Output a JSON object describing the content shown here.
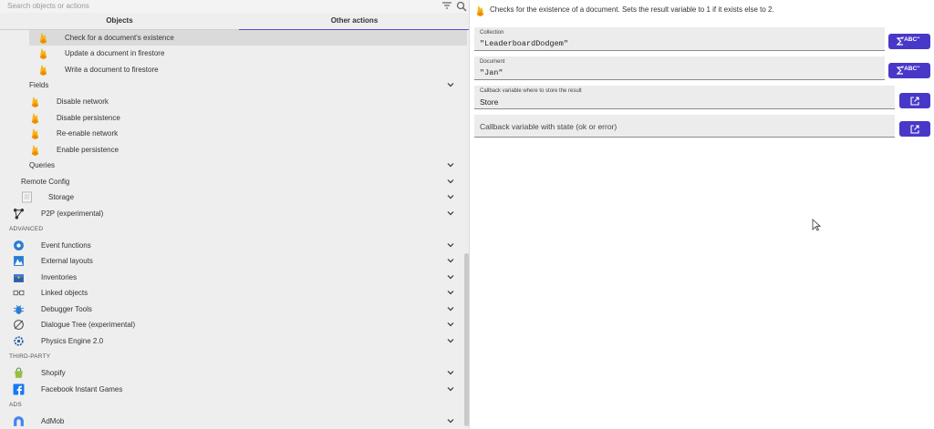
{
  "search": {
    "placeholder": "Search objects or actions"
  },
  "tabs": {
    "objects": "Objects",
    "other_actions": "Other actions"
  },
  "tree": {
    "firestore_actions": [
      "Check for a document's existence",
      "Update a document in firestore",
      "Write a document to firestore"
    ],
    "fields_label": "Fields",
    "fields_actions": [
      "Disable network",
      "Disable persistence",
      "Re-enable network",
      "Enable persistence"
    ],
    "queries_label": "Queries",
    "remote_config_label": "Remote Config",
    "storage_label": "Storage",
    "p2p_label": "P2P (experimental)"
  },
  "sections": {
    "advanced": "ADVANCED",
    "third_party": "THIRD-PARTY",
    "ads": "ADS"
  },
  "advanced": [
    "Event functions",
    "External layouts",
    "Inventories",
    "Linked objects",
    "Debugger Tools",
    "Dialogue Tree (experimental)",
    "Physics Engine 2.0"
  ],
  "third_party": [
    "Shopify",
    "Facebook Instant Games"
  ],
  "ads": [
    "AdMob"
  ],
  "right": {
    "description": "Checks for the existence of a document. Sets the result variable to 1 if it exists else to 2.",
    "collection_label": "Collection",
    "collection_value": "\"LeaderboardDodgem\"",
    "document_label": "Document",
    "document_value": "\"Jan\"",
    "callback_result_label": "Callback variable where to store the result",
    "callback_result_value": "Store",
    "callback_state_placeholder": "Callback variable with state (ok or error)",
    "abc_button": "\"ABC\""
  },
  "colors": {
    "accent": "#4838c8",
    "firebase_yellow": "#f6b21a",
    "firebase_orange": "#f08a00"
  }
}
